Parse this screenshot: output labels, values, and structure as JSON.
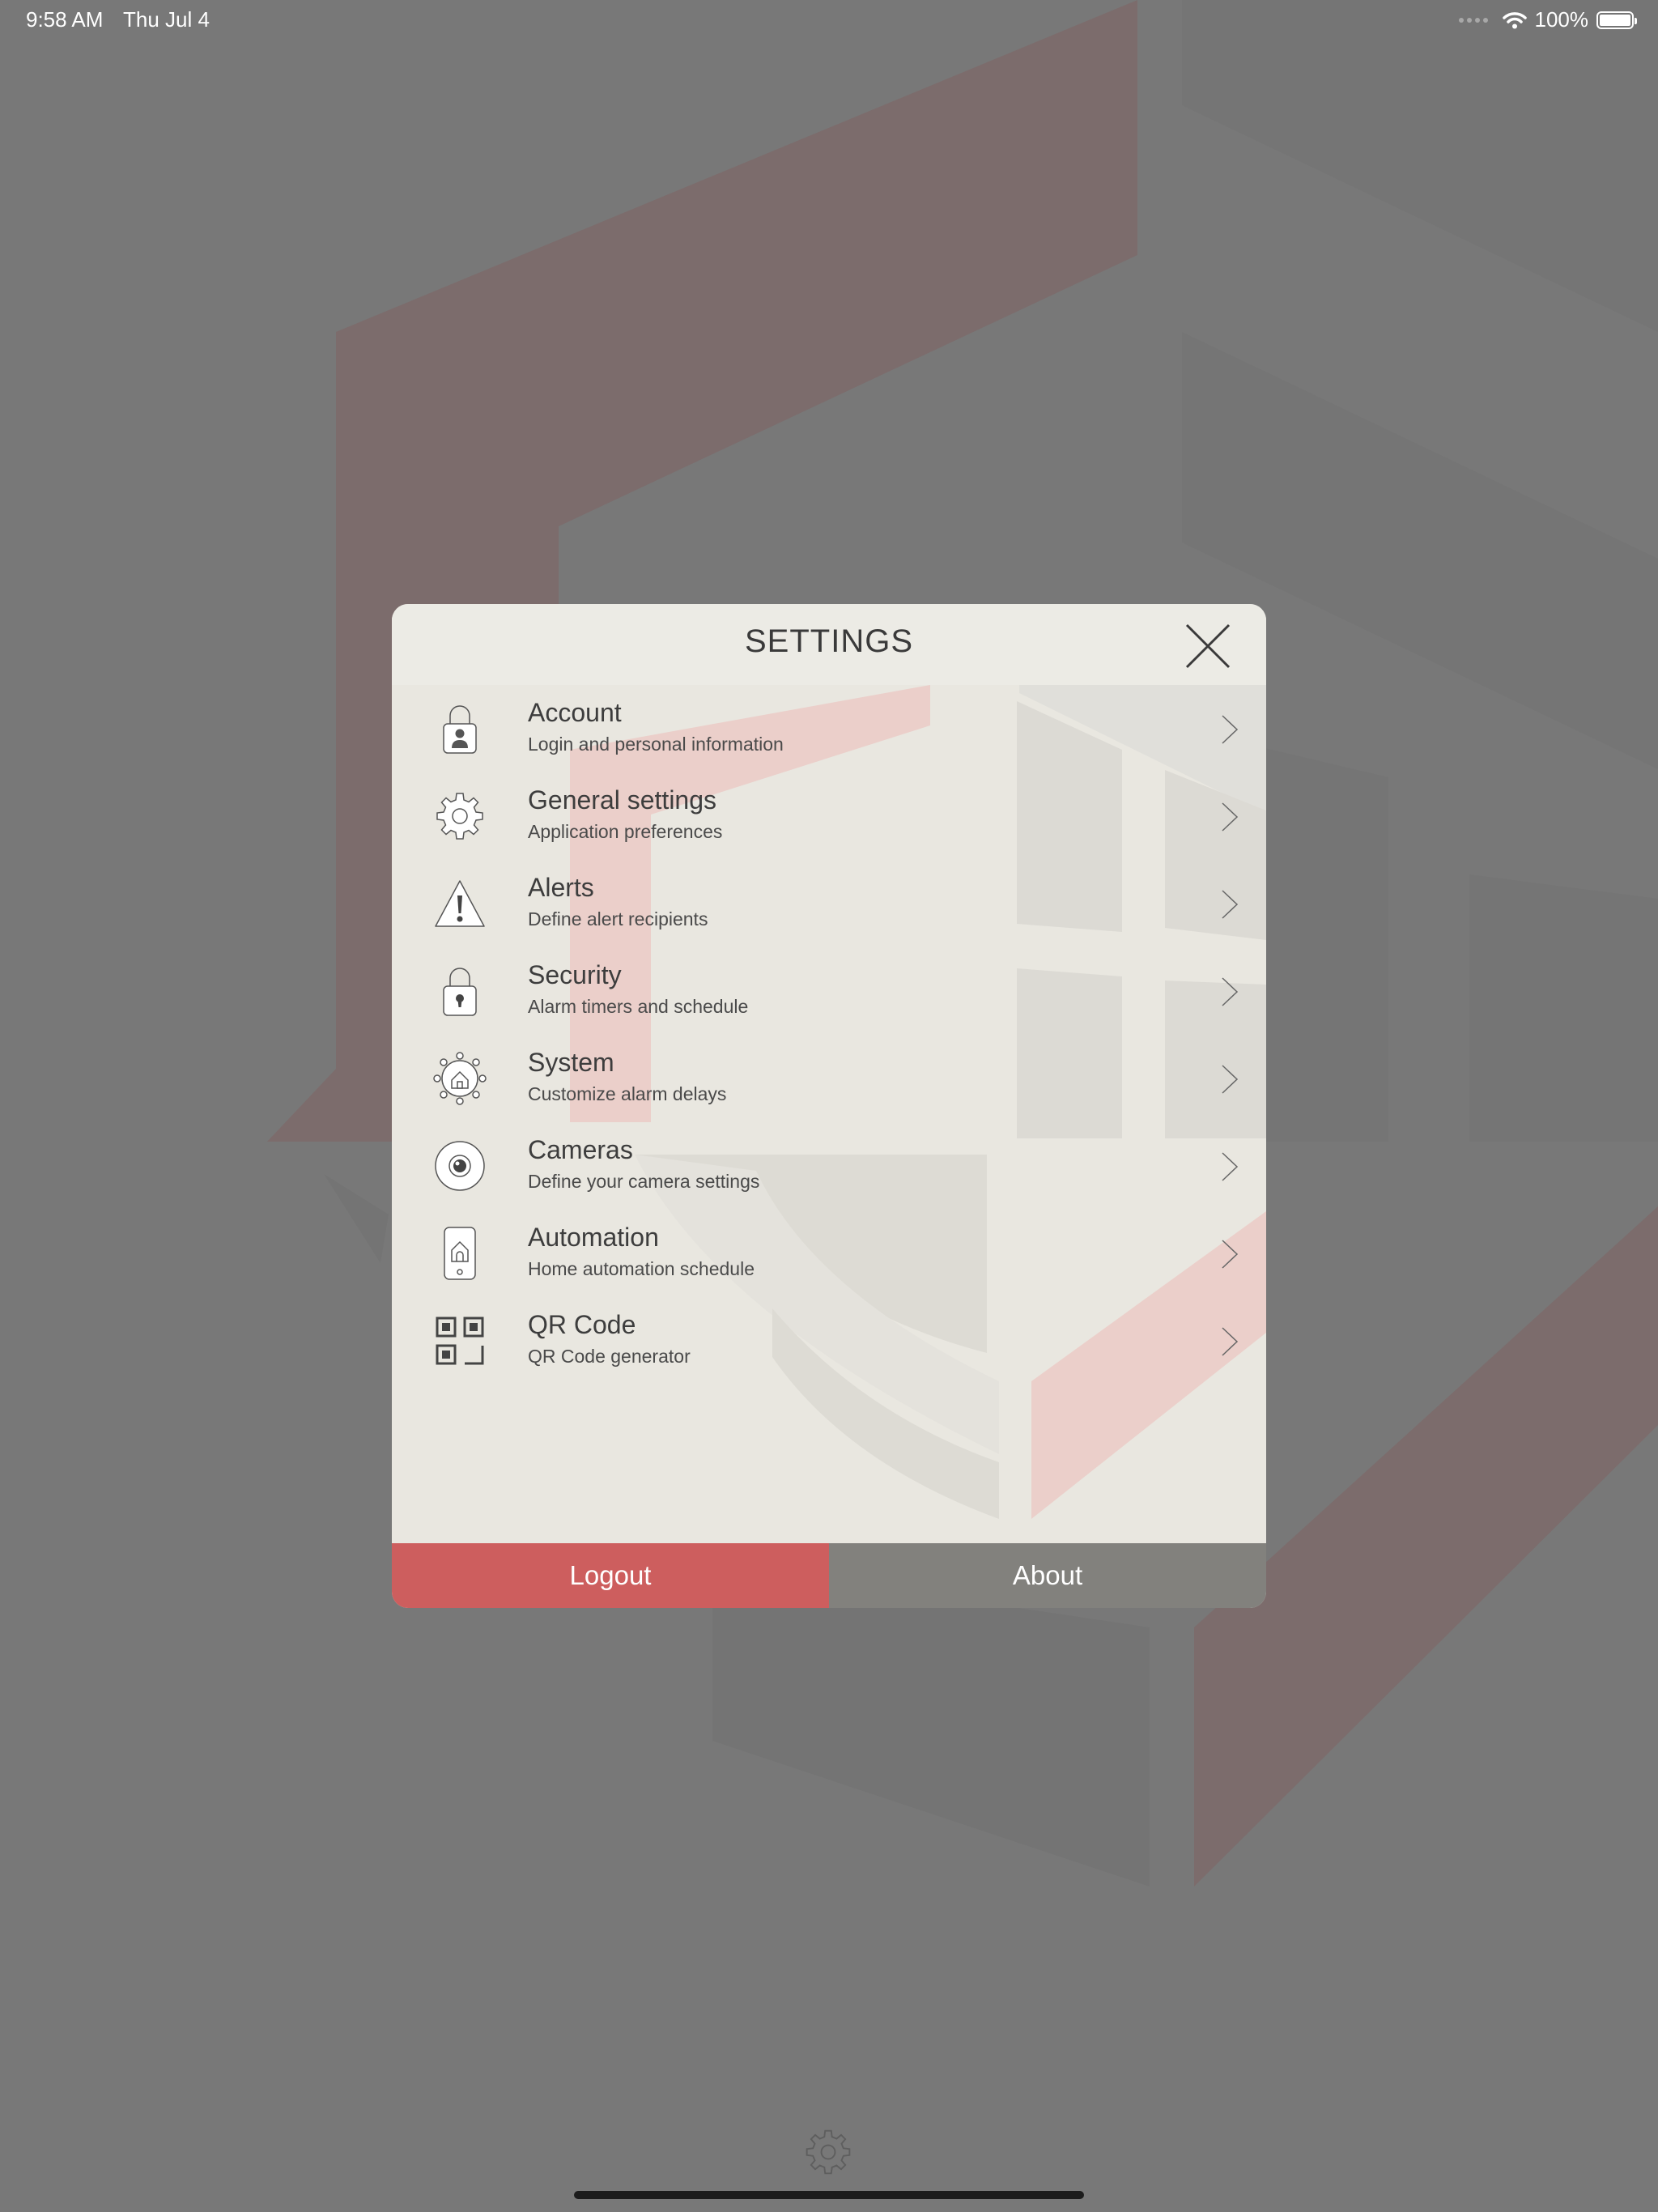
{
  "status_bar": {
    "time": "9:58 AM",
    "date": "Thu Jul 4",
    "battery": "100%"
  },
  "settings": {
    "title": "SETTINGS",
    "items": [
      {
        "title": "Account",
        "subtitle": "Login and personal information",
        "icon": "account-lock-icon"
      },
      {
        "title": "General settings",
        "subtitle": "Application preferences",
        "icon": "gear-icon"
      },
      {
        "title": "Alerts",
        "subtitle": "Define alert recipients",
        "icon": "warning-icon"
      },
      {
        "title": "Security",
        "subtitle": "Alarm timers and schedule",
        "icon": "padlock-icon"
      },
      {
        "title": "System",
        "subtitle": "Customize alarm delays",
        "icon": "system-network-icon"
      },
      {
        "title": "Cameras",
        "subtitle": "Define your camera settings",
        "icon": "camera-eye-icon"
      },
      {
        "title": "Automation",
        "subtitle": "Home automation schedule",
        "icon": "home-phone-icon"
      },
      {
        "title": "QR Code",
        "subtitle": "QR Code generator",
        "icon": "qr-code-icon"
      }
    ],
    "logout_label": "Logout",
    "about_label": "About"
  },
  "colors": {
    "logout": "#cd5e5e",
    "about": "#82817d",
    "panel": "#e9e7e0",
    "backdrop": "#787878"
  }
}
